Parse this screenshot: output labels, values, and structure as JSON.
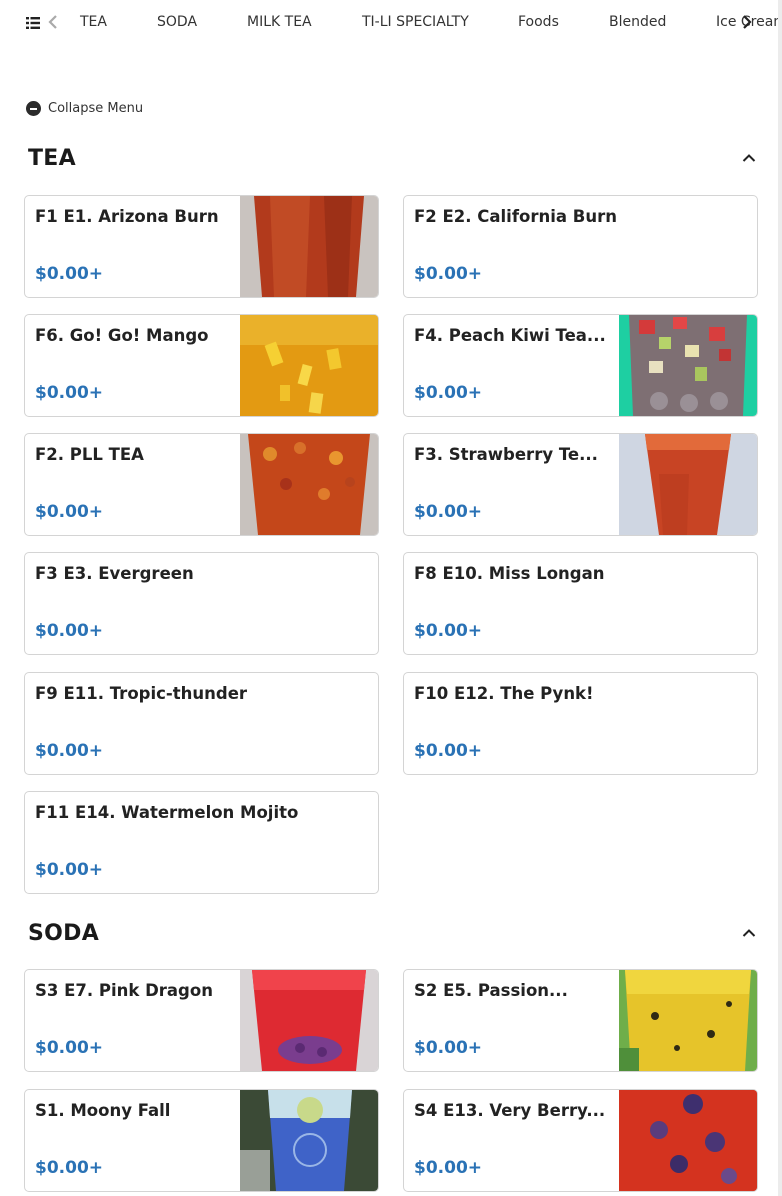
{
  "nav": {
    "categories": [
      "TEA",
      "SODA",
      "MILK TEA",
      "TI-LI SPECIALTY",
      "Foods",
      "Blended",
      "Ice Cream"
    ]
  },
  "collapse_label": "Collapse Menu",
  "price_color": "#2a72b5",
  "sections": [
    {
      "title": "TEA",
      "items": [
        {
          "name": "F1 E1. Arizona Burn",
          "price": "$0.00+",
          "image": "red-iced-tea"
        },
        {
          "name": "F2 E2. California Burn",
          "price": "$0.00+",
          "image": null
        },
        {
          "name": "F6. Go! Go! Mango",
          "price": "$0.00+",
          "image": "mango-tea"
        },
        {
          "name": "F4. Peach Kiwi Tea...",
          "price": "$0.00+",
          "image": "peach-kiwi-tea"
        },
        {
          "name": "F2. PLL TEA",
          "price": "$0.00+",
          "image": "pll-tea"
        },
        {
          "name": "F3. Strawberry Te...",
          "price": "$0.00+",
          "image": "strawberry-tea"
        },
        {
          "name": "F3 E3. Evergreen",
          "price": "$0.00+",
          "image": null
        },
        {
          "name": "F8 E10. Miss Longan",
          "price": "$0.00+",
          "image": null
        },
        {
          "name": "F9 E11. Tropic-thunder",
          "price": "$0.00+",
          "image": null
        },
        {
          "name": "F10 E12. The Pynk!",
          "price": "$0.00+",
          "image": null
        },
        {
          "name": "F11 E14. Watermelon Mojito",
          "price": "$0.00+",
          "image": null
        }
      ]
    },
    {
      "title": "SODA",
      "items": [
        {
          "name": "S3 E7. Pink Dragon",
          "price": "$0.00+",
          "image": "pink-dragon-soda"
        },
        {
          "name": "S2 E5. Passion...",
          "price": "$0.00+",
          "image": "passion-soda"
        },
        {
          "name": "S1. Moony Fall",
          "price": "$0.00+",
          "image": "moony-fall-soda"
        },
        {
          "name": "S4 E13. Very Berry...",
          "price": "$0.00+",
          "image": "very-berry-soda"
        }
      ]
    }
  ]
}
